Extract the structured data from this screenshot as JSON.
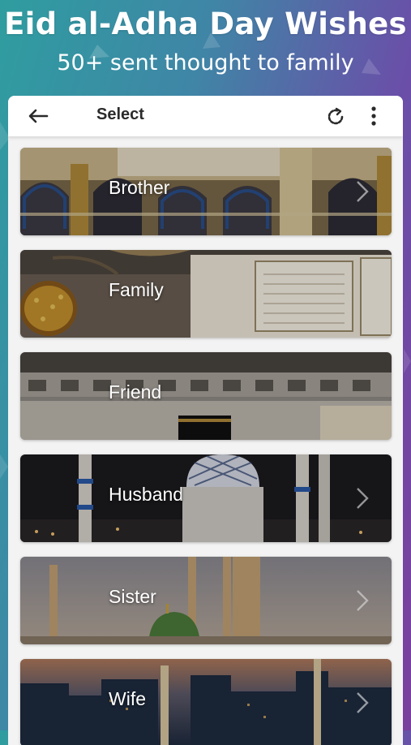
{
  "promo": {
    "title": "Eid al-Adha Day Wishes",
    "subtitle": "50+ sent thought to family"
  },
  "appbar": {
    "title": "Select",
    "back_icon": "arrow-left-icon",
    "refresh_icon": "refresh-icon",
    "more_icon": "more-vertical-icon"
  },
  "categories": [
    {
      "label": "Brother",
      "scene": "mosque-arches"
    },
    {
      "label": "Family",
      "scene": "quran-book"
    },
    {
      "label": "Friend",
      "scene": "kaaba-courtyard"
    },
    {
      "label": "Husband",
      "scene": "mosque-dome-night"
    },
    {
      "label": "Sister",
      "scene": "green-dome-minarets"
    },
    {
      "label": "Wife",
      "scene": "city-skyline-dusk"
    }
  ],
  "colors": {
    "gradient_left": "#2f9da0",
    "gradient_right": "#7a3f9e",
    "appbar_bg": "#ffffff",
    "title_text": "#2a2a2a"
  }
}
